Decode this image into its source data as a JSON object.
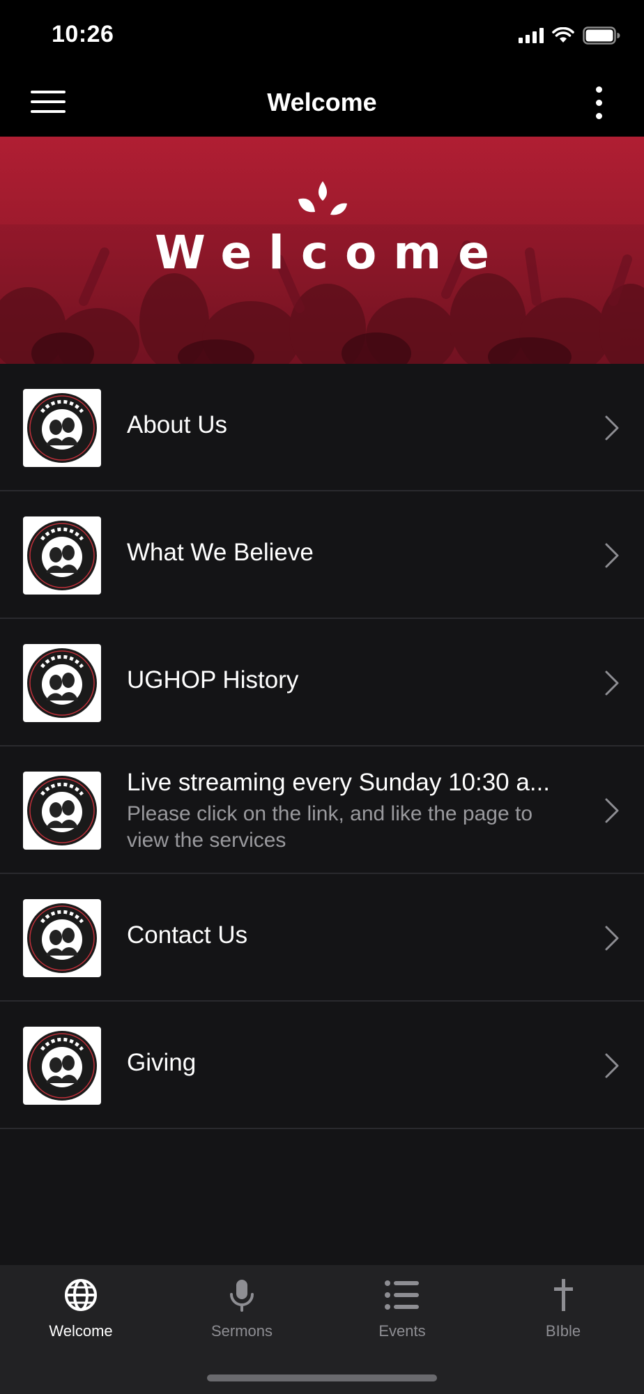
{
  "status_bar": {
    "time": "10:26"
  },
  "nav": {
    "title": "Welcome"
  },
  "hero": {
    "text": "Welcome"
  },
  "list": {
    "items": [
      {
        "title": "About Us",
        "subtitle": ""
      },
      {
        "title": "What We Believe",
        "subtitle": ""
      },
      {
        "title": "UGHOP History",
        "subtitle": ""
      },
      {
        "title": "Live streaming every Sunday 10:30 a...",
        "subtitle": "Please click on the link, and like the page to view the services"
      },
      {
        "title": "Contact Us",
        "subtitle": ""
      },
      {
        "title": "Giving",
        "subtitle": ""
      }
    ]
  },
  "tabs": [
    {
      "label": "Welcome",
      "icon": "globe-icon",
      "active": true
    },
    {
      "label": "Sermons",
      "icon": "microphone-icon",
      "active": false
    },
    {
      "label": "Events",
      "icon": "list-icon",
      "active": false
    },
    {
      "label": "BIble",
      "icon": "cross-icon",
      "active": false
    }
  ],
  "colors": {
    "background": "#141416",
    "bars": "#000000",
    "hero_red": "#b01e33",
    "tab_bar": "#222224",
    "inactive_tab": "#8e8e93",
    "subtitle": "#9a9a9e"
  }
}
